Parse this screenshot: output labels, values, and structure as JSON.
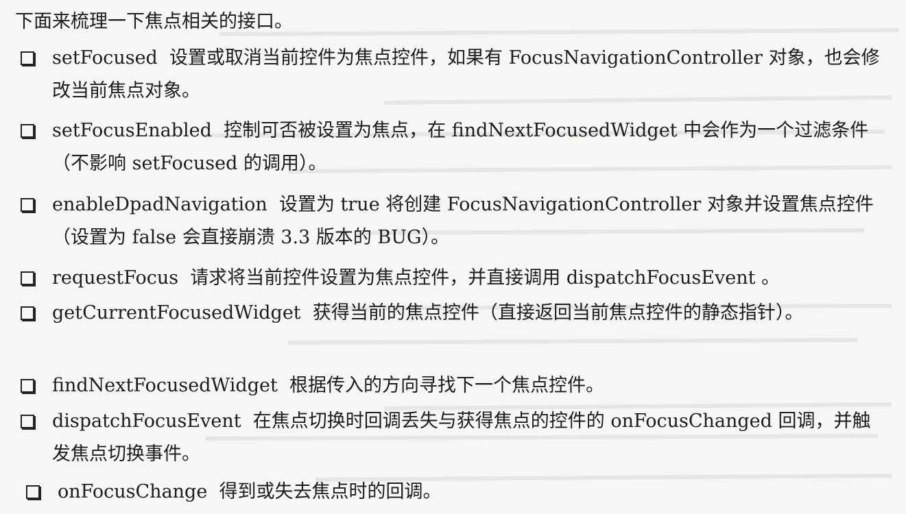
{
  "intro": "下面来梳理一下焦点相关的接口。",
  "items": [
    {
      "name": "setFocused",
      "desc": "设置或取消当前控件为焦点控件，如果有 FocusNavigationController 对象，也会修改当前焦点对象。"
    },
    {
      "name": "setFocusEnabled",
      "desc": "控制可否被设置为焦点，在 findNextFocusedWidget 中会作为一个过滤条件（不影响 setFocused 的调用）。"
    },
    {
      "name": "enableDpadNavigation",
      "desc": "设置为 true 将创建 FocusNavigationController 对象并设置焦点控件（设置为 false 会直接崩溃 3.3 版本的 BUG）。"
    },
    {
      "name": "requestFocus",
      "desc": "请求将当前控件设置为焦点控件，并直接调用 dispatchFocusEvent 。"
    },
    {
      "name": "getCurrentFocusedWidget",
      "desc": "获得当前的焦点控件（直接返回当前焦点控件的静态指针）。"
    },
    {
      "name": "findNextFocusedWidget",
      "desc": "根据传入的方向寻找下一个焦点控件。"
    },
    {
      "name": "dispatchFocusEvent",
      "desc": "在焦点切换时回调丢失与获得焦点的控件的 onFocusChanged 回调，并触发焦点切换事件。"
    },
    {
      "name": "onFocusChange",
      "desc": "得到或失去焦点时的回调。"
    }
  ]
}
